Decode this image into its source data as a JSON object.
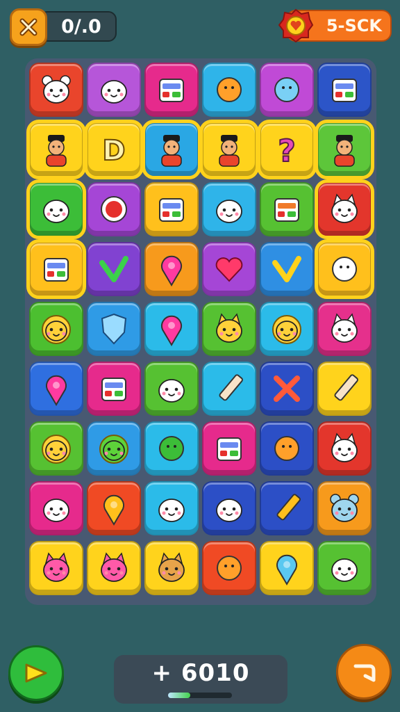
{
  "hud": {
    "close_icon": "x-icon",
    "counter": "0/.0",
    "level_label": "5-SCK",
    "level_badge_icon": "heart-badge-icon"
  },
  "board": {
    "rows": [
      [
        {
          "name": "white-bear-icon",
          "bg": "#e9452c"
        },
        {
          "name": "fluffy-sheep-icon",
          "bg": "#b656d9"
        },
        {
          "name": "house-icon",
          "bg": "#e62a8c"
        },
        {
          "name": "yellow-bird-icon",
          "bg": "#2fb4e9"
        },
        {
          "name": "magnifier-icon",
          "bg": "#c04ad6"
        },
        {
          "name": "calendar-icon",
          "bg": "#2c55c8"
        }
      ],
      [
        {
          "name": "striped-hat-person-icon",
          "bg": "#ffd31c",
          "selected": true
        },
        {
          "name": "letter-d-icon",
          "bg": "#ffd31c",
          "selected": true
        },
        {
          "name": "graduate-icon",
          "bg": "#2aa7e4",
          "selected": true
        },
        {
          "name": "boy-with-cap-icon",
          "bg": "#ffd31c",
          "selected": true
        },
        {
          "name": "question-mark-icon",
          "bg": "#ffd31c",
          "selected": true
        },
        {
          "name": "man-red-shirt-icon",
          "bg": "#5dc63a",
          "selected": true
        }
      ],
      [
        {
          "name": "white-seal-icon",
          "bg": "#3cbd38",
          "selected": true
        },
        {
          "name": "red-circle-icon",
          "bg": "#a546d6"
        },
        {
          "name": "gift-box-icon",
          "bg": "#ffc01c"
        },
        {
          "name": "white-ghost-icon",
          "bg": "#2fb4e9"
        },
        {
          "name": "burger-stack-icon",
          "bg": "#56c132"
        },
        {
          "name": "white-cat-icon",
          "bg": "#e3362c",
          "selected": true
        }
      ],
      [
        {
          "name": "cassette-icon",
          "bg": "#ffc01c",
          "selected": true
        },
        {
          "name": "green-arrow-icon",
          "bg": "#8142d1"
        },
        {
          "name": "pink-flower-icon",
          "bg": "#f79a1c"
        },
        {
          "name": "pink-heart-icon",
          "bg": "#a546d6"
        },
        {
          "name": "yellow-check-icon",
          "bg": "#2f8fe3"
        },
        {
          "name": "horseshoe-icon",
          "bg": "#ffc01c",
          "selected": true
        }
      ],
      [
        {
          "name": "sun-face-icon",
          "bg": "#4cbf30"
        },
        {
          "name": "blue-shield-icon",
          "bg": "#2f9be6"
        },
        {
          "name": "pink-blob-icon",
          "bg": "#2bbbe9"
        },
        {
          "name": "yellow-cat-icon",
          "bg": "#56c132"
        },
        {
          "name": "smiley-face-icon",
          "bg": "#2bbbe9"
        },
        {
          "name": "white-bunny-icon",
          "bg": "#e5308c"
        }
      ],
      [
        {
          "name": "pink-ball-icon",
          "bg": "#2f6fe0"
        },
        {
          "name": "arcade-machine-icon",
          "bg": "#e62a8c"
        },
        {
          "name": "white-puffer-icon",
          "bg": "#56c132"
        },
        {
          "name": "pencil-icon",
          "bg": "#2bbbe9"
        },
        {
          "name": "crossed-tools-icon",
          "bg": "#2c4fc6"
        },
        {
          "name": "paint-brush-icon",
          "bg": "#ffd31c"
        }
      ],
      [
        {
          "name": "yellow-critter-icon",
          "bg": "#56c132"
        },
        {
          "name": "green-sun-icon",
          "bg": "#2f9be6"
        },
        {
          "name": "leaf-icon",
          "bg": "#2bbbe9"
        },
        {
          "name": "web-window-icon",
          "bg": "#e62a8c"
        },
        {
          "name": "orange-fish-icon",
          "bg": "#2c4fc6"
        },
        {
          "name": "white-kitten-icon",
          "bg": "#e3362c"
        }
      ],
      [
        {
          "name": "white-marshmallow-icon",
          "bg": "#e62a8c"
        },
        {
          "name": "yellow-pin-icon",
          "bg": "#f04a24"
        },
        {
          "name": "white-seal-pup-icon",
          "bg": "#2bbbe9"
        },
        {
          "name": "white-ghost-pup-icon",
          "bg": "#2c4fc6"
        },
        {
          "name": "crayon-icon",
          "bg": "#2c4fc6"
        },
        {
          "name": "blue-bear-icon",
          "bg": "#f79a1c"
        }
      ],
      [
        {
          "name": "pink-location-pin-icon",
          "bg": "#ffd31c"
        },
        {
          "name": "pink-cat-icon",
          "bg": "#ffd31c"
        },
        {
          "name": "brown-cat-icon",
          "bg": "#ffd31c"
        },
        {
          "name": "fried-egg-icon",
          "bg": "#f04a24"
        },
        {
          "name": "blue-balloon-icon",
          "bg": "#ffd31c"
        },
        {
          "name": "red-hat-seal-icon",
          "bg": "#56c132"
        }
      ]
    ]
  },
  "footer": {
    "play_icon": "play-icon",
    "score": "+ 6010",
    "progress": 0.35,
    "undo_icon": "undo-icon"
  }
}
